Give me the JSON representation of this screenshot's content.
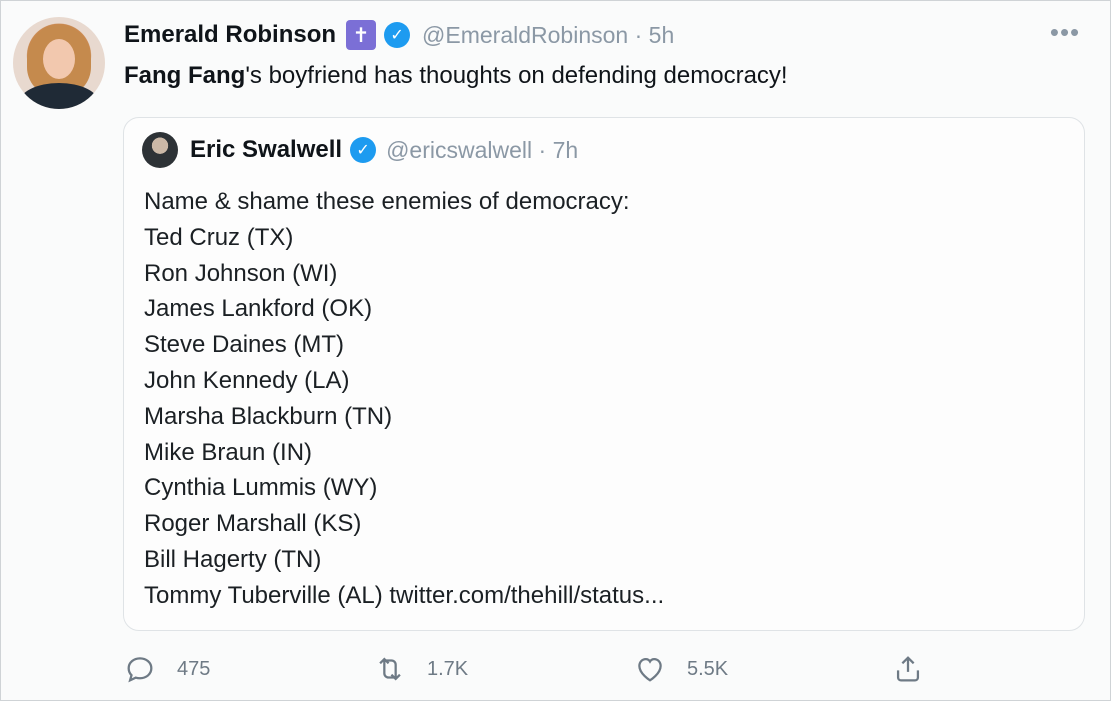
{
  "author": {
    "name": "Emerald Robinson",
    "badge_symbol": "✝",
    "handle": "@EmeraldRobinson",
    "separator": " · ",
    "time": "5h"
  },
  "tweet": {
    "bold_part": "Fang Fang",
    "rest": "'s boyfriend has thoughts on defending democracy!"
  },
  "quoted": {
    "name": "Eric Swalwell",
    "handle": "@ericswalwell",
    "separator": " · ",
    "time": "7h",
    "lines": [
      "Name & shame these enemies of democracy:",
      "Ted Cruz (TX)",
      "Ron Johnson (WI)",
      "James Lankford (OK)",
      "Steve Daines (MT)",
      "John Kennedy (LA)",
      "Marsha Blackburn (TN)",
      "Mike Braun (IN)",
      "Cynthia Lummis (WY)",
      "Roger Marshall (KS)",
      "Bill Hagerty (TN)"
    ],
    "last_line_text": "Tommy Tuberville (AL) ",
    "link": "twitter.com/thehill/status..."
  },
  "actions": {
    "replies": "475",
    "retweets": "1.7K",
    "likes": "5.5K"
  },
  "colors": {
    "verified": "#1d9bf0",
    "badge": "#7b6fd6",
    "muted": "#8b98a5"
  },
  "icons": [
    "more-icon",
    "verified-icon",
    "cross-badge-icon",
    "reply-icon",
    "retweet-icon",
    "like-icon",
    "share-icon"
  ]
}
